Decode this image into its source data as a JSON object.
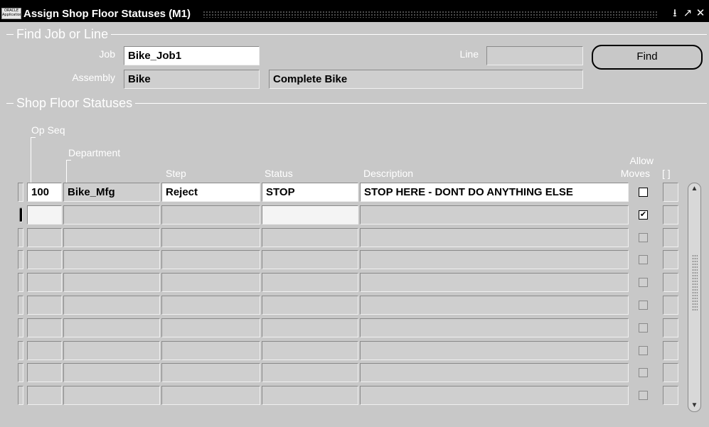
{
  "window": {
    "title": "Assign Shop Floor Statuses (M1)",
    "app_icon_text": "ORACLE Applications",
    "controls": [
      "minimize-icon",
      "maximize-icon",
      "close-icon"
    ]
  },
  "find_section": {
    "title": "Find Job or Line",
    "job_label": "Job",
    "job_value": "Bike_Job1",
    "line_label": "Line",
    "line_value": "",
    "assembly_label": "Assembly",
    "assembly_value": "Bike",
    "assembly_description": "Complete Bike",
    "find_button": "Find"
  },
  "statuses_section": {
    "title": "Shop Floor Statuses",
    "columns": {
      "op_seq": "Op Seq",
      "department": "Department",
      "step": "Step",
      "status": "Status",
      "description": "Description",
      "allow_moves_1": "Allow",
      "allow_moves_2": "Moves",
      "flex": "[ ]"
    },
    "rows": [
      {
        "op_seq": "100",
        "department": "Bike_Mfg",
        "step": "Reject",
        "status": "STOP",
        "description": "STOP HERE - DONT DO ANYTHING ELSE",
        "allow_moves": false
      },
      {
        "op_seq": "",
        "department": "",
        "step": "",
        "status": "",
        "description": "",
        "allow_moves": true
      },
      {
        "op_seq": "",
        "department": "",
        "step": "",
        "status": "",
        "description": "",
        "allow_moves": false
      },
      {
        "op_seq": "",
        "department": "",
        "step": "",
        "status": "",
        "description": "",
        "allow_moves": false
      },
      {
        "op_seq": "",
        "department": "",
        "step": "",
        "status": "",
        "description": "",
        "allow_moves": false
      },
      {
        "op_seq": "",
        "department": "",
        "step": "",
        "status": "",
        "description": "",
        "allow_moves": false
      },
      {
        "op_seq": "",
        "department": "",
        "step": "",
        "status": "",
        "description": "",
        "allow_moves": false
      },
      {
        "op_seq": "",
        "department": "",
        "step": "",
        "status": "",
        "description": "",
        "allow_moves": false
      },
      {
        "op_seq": "",
        "department": "",
        "step": "",
        "status": "",
        "description": "",
        "allow_moves": false
      },
      {
        "op_seq": "",
        "department": "",
        "step": "",
        "status": "",
        "description": "",
        "allow_moves": false
      }
    ]
  },
  "colors": {
    "titlebar": "#000000",
    "background": "#c8c8c8",
    "field_enabled": "#ffffff",
    "field_disabled": "#cfcfcf"
  }
}
